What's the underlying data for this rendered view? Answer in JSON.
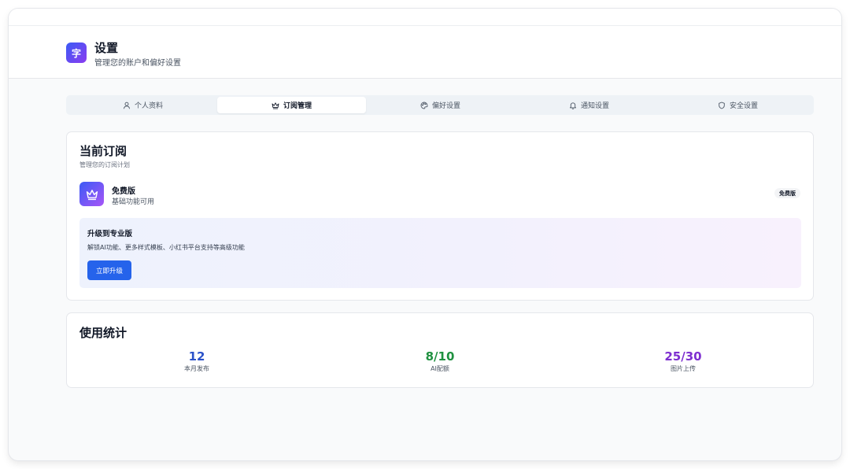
{
  "header": {
    "logo_char": "字",
    "title": "设置",
    "subtitle": "管理您的账户和偏好设置"
  },
  "tabs": [
    {
      "label": "个人资料",
      "icon": "user-icon",
      "active": false
    },
    {
      "label": "订阅管理",
      "icon": "crown-icon",
      "active": true
    },
    {
      "label": "偏好设置",
      "icon": "palette-icon",
      "active": false
    },
    {
      "label": "通知设置",
      "icon": "bell-icon",
      "active": false
    },
    {
      "label": "安全设置",
      "icon": "shield-icon",
      "active": false
    }
  ],
  "subscription": {
    "title": "当前订阅",
    "description": "管理您的订阅计划",
    "plan": {
      "icon": "crown-icon",
      "name": "免费版",
      "description": "基础功能可用",
      "badge": "免费版"
    },
    "upgrade": {
      "title": "升级到专业版",
      "description": "解锁AI功能、更多样式模板、小红书平台支持等高级功能",
      "button": "立即升级"
    }
  },
  "usage": {
    "title": "使用统计",
    "stats": [
      {
        "value": "12",
        "label": "本月发布",
        "color": "#2b52c9"
      },
      {
        "value": "8/10",
        "label": "AI配额",
        "color": "#1f9140"
      },
      {
        "value": "25/30",
        "label": "图片上传",
        "color": "#7e2fd0"
      }
    ]
  },
  "colors": {
    "accent": "#2563eb",
    "brand_gradient_start": "#3b5bf5",
    "brand_gradient_end": "#8b3cf0"
  }
}
